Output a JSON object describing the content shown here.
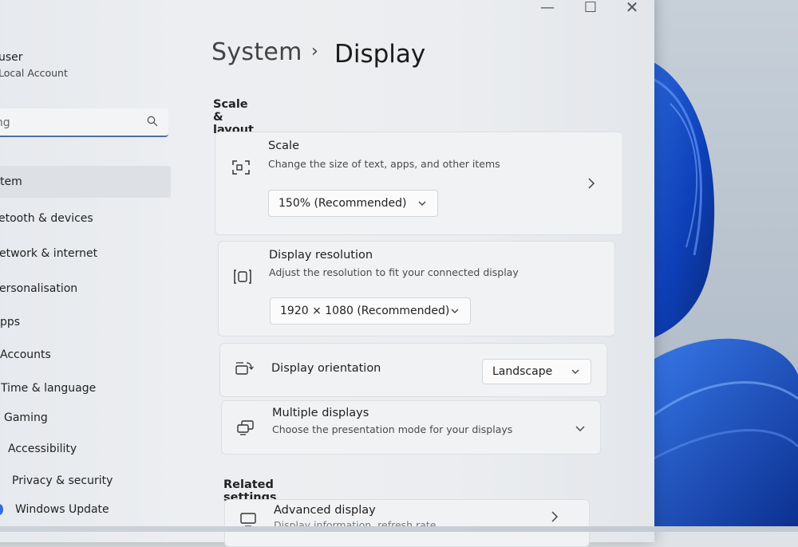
{
  "window": {
    "controls": {
      "minimize": "—",
      "maximize": "☐",
      "close": "✕"
    }
  },
  "sidebar": {
    "user": {
      "name": "user",
      "account": "Local Account"
    },
    "search": {
      "value": "tting",
      "icon": "search-icon"
    },
    "items": [
      {
        "label": "tem",
        "active": true
      },
      {
        "label": "etooth & devices"
      },
      {
        "label": "etwork & internet"
      },
      {
        "label": "ersonalisation"
      },
      {
        "label": "pps"
      },
      {
        "label": "Accounts"
      },
      {
        "label": "Time & language"
      },
      {
        "label": "Gaming"
      },
      {
        "label": "Accessibility"
      },
      {
        "label": "Privacy & security"
      },
      {
        "label": "Windows Update"
      }
    ]
  },
  "breadcrumb": {
    "parent": "System",
    "separator": "›",
    "current": "Display"
  },
  "sections": {
    "scale_layout": "Scale & layout",
    "related": "Related settings"
  },
  "cards": {
    "scale": {
      "title": "Scale",
      "subtitle": "Change the size of text, apps, and other items",
      "dropdown": "150% (Recommended)",
      "icon": "scale-icon"
    },
    "resolution": {
      "title": "Display resolution",
      "subtitle": "Adjust the resolution to fit your connected display",
      "dropdown": "1920 × 1080 (Recommended)",
      "icon": "resolution-icon"
    },
    "orientation": {
      "title": "Display orientation",
      "dropdown": "Landscape",
      "icon": "orientation-icon"
    },
    "multiple": {
      "title": "Multiple displays",
      "subtitle": "Choose the presentation mode for your displays",
      "icon": "multiple-displays-icon"
    },
    "advanced": {
      "title": "Advanced display",
      "subtitle": "Display information, refresh rate",
      "icon": "monitor-icon"
    }
  },
  "colors": {
    "accent": "#4a6fa5",
    "wallpaper_blue": "#1a4fc9"
  }
}
